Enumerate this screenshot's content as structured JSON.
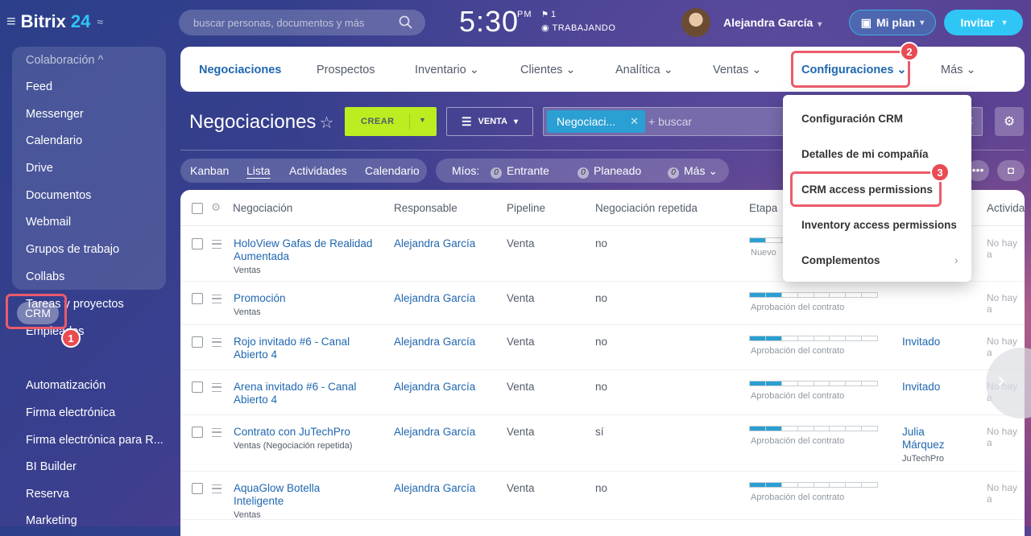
{
  "topbar": {
    "app_name_1": "Bitrix",
    "app_name_2": "24",
    "search_placeholder": "buscar personas, documentos y más",
    "clock": "5:30",
    "clock_ampm": "PM",
    "flag_count": "1",
    "status": "TRABAJANDO",
    "user_name": "Alejandra García",
    "plan_label": "Mi plan",
    "invite_label": "Invitar"
  },
  "sidebar": {
    "group_label": "Colaboración ^",
    "items": [
      "Feed",
      "Messenger",
      "Calendario",
      "Drive",
      "Documentos",
      "Webmail",
      "Grupos de trabajo",
      "Collabs",
      "Tareas y proyectos",
      "Empleados",
      "CRM",
      "Automatización",
      "Firma electrónica",
      "Firma electrónica para R...",
      "BI Builder",
      "Reserva",
      "Marketing"
    ]
  },
  "badges": [
    "1",
    "2",
    "3"
  ],
  "tabs": [
    "Negociaciones",
    "Prospectos",
    "Inventario ⌄",
    "Clientes ⌄",
    "Analítica ⌄",
    "Ventas ⌄",
    "Configuraciones ⌄",
    "Más ⌄"
  ],
  "page": {
    "title": "Negociaciones",
    "create_label": "CREAR",
    "pipeline_label": "VENTA",
    "filter_chip": "Negociaci...",
    "filter_placeholder": "+ buscar"
  },
  "views": [
    "Kanban",
    "Lista",
    "Actividades",
    "Calendario"
  ],
  "counters": {
    "label": "Míos:",
    "items": [
      {
        "count": "0",
        "label": "Entrante"
      },
      {
        "count": "0",
        "label": "Planeado"
      },
      {
        "count": "0",
        "label": "Más ⌄"
      }
    ]
  },
  "table": {
    "headers": [
      "Negociación",
      "Responsable",
      "Pipeline",
      "Negociación repetida",
      "Etapa",
      "Activida"
    ],
    "rows": [
      {
        "name_1": "HoloView Gafas de Realidad",
        "name_2": "Aumentada",
        "sub": "Ventas",
        "resp": "Alejandra García",
        "pipeline": "Venta",
        "repeat": "no",
        "stage": "Nuevo",
        "filled": 1,
        "contact": "",
        "contact2": "",
        "company": "",
        "activity": "No hay a"
      },
      {
        "name_1": "Promoción",
        "name_2": "",
        "sub": "Ventas",
        "resp": "Alejandra García",
        "pipeline": "Venta",
        "repeat": "no",
        "stage": "Aprobación del contrato",
        "filled": 2,
        "contact": "",
        "contact2": "",
        "company": "",
        "activity": "No hay a"
      },
      {
        "name_1": "Rojo invitado #6 - Canal",
        "name_2": "Abierto 4",
        "sub": "",
        "resp": "Alejandra García",
        "pipeline": "Venta",
        "repeat": "no",
        "stage": "Aprobación del contrato",
        "filled": 2,
        "contact": "Invitado",
        "contact2": "",
        "company": "",
        "activity": "No hay a"
      },
      {
        "name_1": "Arena invitado #6 - Canal",
        "name_2": "Abierto 4",
        "sub": "",
        "resp": "Alejandra García",
        "pipeline": "Venta",
        "repeat": "no",
        "stage": "Aprobación del contrato",
        "filled": 2,
        "contact": "Invitado",
        "contact2": "",
        "company": "",
        "activity": "No hay a"
      },
      {
        "name_1": "Contrato con JuTechPro",
        "name_2": "",
        "sub": "Ventas (Negociación repetida)",
        "resp": "Alejandra García",
        "pipeline": "Venta",
        "repeat": "sí",
        "stage": "Aprobación del contrato",
        "filled": 2,
        "contact": "Julia",
        "contact2": "Márquez",
        "company": "JuTechPro",
        "activity": "No hay a"
      },
      {
        "name_1": "AquaGlow Botella",
        "name_2": "Inteligente",
        "sub": "Ventas",
        "resp": "Alejandra García",
        "pipeline": "Venta",
        "repeat": "no",
        "stage": "Aprobación del contrato",
        "filled": 2,
        "contact": "",
        "contact2": "",
        "company": "",
        "activity": "No hay a"
      }
    ]
  },
  "dropdown": {
    "items": [
      "Configuración CRM",
      "Detalles de mi compañía",
      "CRM access permissions",
      "Inventory access permissions",
      "Complementos"
    ]
  },
  "colors": {
    "accent": "#2fc6f6",
    "create": "#bbed21",
    "highlight": "#ec5b6b",
    "link": "#2067b0"
  }
}
